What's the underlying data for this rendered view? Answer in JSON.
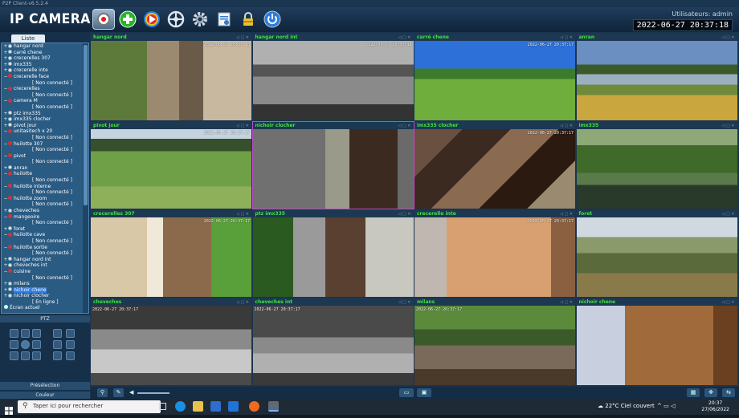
{
  "window": {
    "title": "P2P Client-v6.5.2.4"
  },
  "header": {
    "brand": "IP CAMERA",
    "user_label": "Utilisateurs: admin",
    "datetime": "2022-06-27 20:37:18"
  },
  "sidebar": {
    "tab_label": "Liste",
    "items": [
      {
        "type": "node",
        "label": "hangar nord",
        "state": "ok"
      },
      {
        "type": "node",
        "label": "carré chene",
        "state": "ok"
      },
      {
        "type": "node",
        "label": "crecerelles 307",
        "state": "ok"
      },
      {
        "type": "node",
        "label": "imx335",
        "state": "ok"
      },
      {
        "type": "node",
        "label": "crecerelle inte",
        "state": "ok"
      },
      {
        "type": "node",
        "label": "crecerelle face",
        "state": "off"
      },
      {
        "type": "sub",
        "label": "[ Non connecté ]"
      },
      {
        "type": "node",
        "label": "crecerelles",
        "state": "off"
      },
      {
        "type": "sub",
        "label": "[ Non connecté ]"
      },
      {
        "type": "node",
        "label": "camera M",
        "state": "off"
      },
      {
        "type": "sub",
        "label": "[ Non connecté ]"
      },
      {
        "type": "node",
        "label": "ptz imx335",
        "state": "ok"
      },
      {
        "type": "node",
        "label": "imx335 clocher",
        "state": "ok"
      },
      {
        "type": "node",
        "label": "pivot jour",
        "state": "ok"
      },
      {
        "type": "node",
        "label": "unitasitech x 20",
        "state": "off"
      },
      {
        "type": "sub",
        "label": "[ Non connecté ]"
      },
      {
        "type": "node",
        "label": "huilotte 307",
        "state": "off"
      },
      {
        "type": "sub",
        "label": "[ Non connecté ]"
      },
      {
        "type": "node",
        "label": "pivot",
        "state": "off"
      },
      {
        "type": "sub",
        "label": "[ Non connecté ]"
      },
      {
        "type": "node",
        "label": "anran",
        "state": "ok"
      },
      {
        "type": "node",
        "label": "huilotte",
        "state": "off"
      },
      {
        "type": "sub",
        "label": "[ Non connecté ]"
      },
      {
        "type": "node",
        "label": "huilotte interne",
        "state": "off"
      },
      {
        "type": "sub",
        "label": "[ Non connecté ]"
      },
      {
        "type": "node",
        "label": "huilotte zoom",
        "state": "off"
      },
      {
        "type": "sub",
        "label": "[ Non connecté ]"
      },
      {
        "type": "node",
        "label": "cheveches",
        "state": "ok"
      },
      {
        "type": "node",
        "label": "mangeoire",
        "state": "off"
      },
      {
        "type": "sub",
        "label": "[ Non connecté ]"
      },
      {
        "type": "node",
        "label": "foret",
        "state": "ok"
      },
      {
        "type": "node",
        "label": "huilotte cave",
        "state": "off"
      },
      {
        "type": "sub",
        "label": "[ Non connecté ]"
      },
      {
        "type": "node",
        "label": "huilotte sortie",
        "state": "off"
      },
      {
        "type": "sub",
        "label": "[ Non connecté ]"
      },
      {
        "type": "node",
        "label": "hangar nord int",
        "state": "ok"
      },
      {
        "type": "node",
        "label": "cheveches int",
        "state": "ok"
      },
      {
        "type": "node",
        "label": "cuisine",
        "state": "off"
      },
      {
        "type": "sub",
        "label": "[ Non connecté ]"
      },
      {
        "type": "node",
        "label": "milans",
        "state": "ok"
      },
      {
        "type": "node",
        "label": "nichoir chene",
        "state": "ok",
        "selected": true
      },
      {
        "type": "node",
        "label": "nichoir clocher",
        "state": "ok"
      },
      {
        "type": "sub",
        "label": "[ En ligne ]"
      }
    ],
    "screen_current": "Écran actuel",
    "ptz_label": "PTZ",
    "preset_label": "Présélection",
    "color_label": "Couleur"
  },
  "cameras": [
    {
      "name": "hangar nord",
      "timestamp": "2022-06-27 20:37:18",
      "scene": "hangar"
    },
    {
      "name": "hangar nord int",
      "timestamp": "2022-06-27 20:37:18",
      "scene": "hangarint"
    },
    {
      "name": "carré chene",
      "timestamp": "2022-06-27 20:37:17",
      "scene": "field"
    },
    {
      "name": "anran",
      "timestamp": "",
      "scene": "pond"
    },
    {
      "name": "pivot jour",
      "timestamp": "2022-06-27 20:37:17",
      "scene": "crops"
    },
    {
      "name": "nichoir clocher",
      "timestamp": "",
      "scene": "stone",
      "highlight": true
    },
    {
      "name": "imx335 clocher",
      "timestamp": "2022-06-27 20:37:17",
      "scene": "attic"
    },
    {
      "name": "imx335",
      "timestamp": "",
      "scene": "creek"
    },
    {
      "name": "crecerelles 307",
      "timestamp": "2022-06-27 20:37:17",
      "scene": "nest1"
    },
    {
      "name": "ptz imx335",
      "timestamp": "",
      "scene": "pipe"
    },
    {
      "name": "crecerelle inte",
      "timestamp": "2022-06-27 20:37:17",
      "scene": "nest2"
    },
    {
      "name": "foret",
      "timestamp": "",
      "scene": "forest"
    },
    {
      "name": "cheveches",
      "timestamp": "2022-06-27 20:37:17",
      "scene": "owlbox",
      "tsLeft": true
    },
    {
      "name": "cheveches int",
      "timestamp": "2022-06-27 20:37:17",
      "scene": "owlint",
      "tsLeft": true
    },
    {
      "name": "milans",
      "timestamp": "2022-06-27 20:37:17",
      "scene": "eagle",
      "tsLeft": true
    },
    {
      "name": "nichoir chene",
      "timestamp": "",
      "scene": "woodbox"
    }
  ],
  "taskbar": {
    "search_placeholder": "Taper ici pour rechercher",
    "weather": "22°C  Ciel couvert",
    "time": "20:37",
    "date": "27/06/2022"
  }
}
